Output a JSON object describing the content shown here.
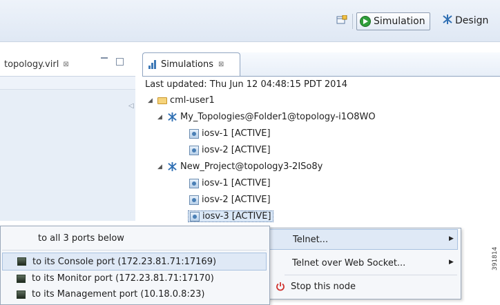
{
  "toolbar": {
    "open_perspective_icon": "open-perspective-icon",
    "perspectives": [
      {
        "label": "Simulation",
        "icon": "simulation-play-icon",
        "active": true
      },
      {
        "label": "Design",
        "icon": "design-topology-icon",
        "active": false
      }
    ]
  },
  "left_panel": {
    "tab_label": "topology.virl",
    "close_glyph": "⊠",
    "collapse_glyph": "◁"
  },
  "simulations": {
    "tab_label": "Simulations",
    "close_glyph": "⊠",
    "last_updated": "Last updated: Thu Jun 12 04:48:15 PDT 2014",
    "tree": {
      "user": "cml-user1",
      "topologies": [
        {
          "label": "My_Topologies@Folder1@topology-i1O8WO",
          "nodes": [
            "iosv-1 [ACTIVE]",
            "iosv-2 [ACTIVE]"
          ]
        },
        {
          "label": "New_Project@topology3-2ISo8y",
          "nodes": [
            "iosv-1 [ACTIVE]",
            "iosv-2 [ACTIVE]",
            "iosv-3 [ACTIVE]"
          ]
        }
      ]
    }
  },
  "context_menu": {
    "items": [
      {
        "label": "Telnet...",
        "submenu": true,
        "highlighted": true
      },
      {
        "label": "Telnet over Web Socket...",
        "submenu": true,
        "highlighted": false
      },
      {
        "label": "Stop this node",
        "icon": "power-icon",
        "highlighted": false
      }
    ]
  },
  "telnet_submenu": {
    "items": [
      {
        "label": "to all 3 ports below",
        "icon": null,
        "highlighted": false
      },
      {
        "label": "to its Console port (172.23.81.71:17169)",
        "icon": "terminal-icon",
        "highlighted": true
      },
      {
        "label": "to its Monitor port (172.23.81.71:17170)",
        "icon": "terminal-icon",
        "highlighted": false
      },
      {
        "label": "to its Management port (10.18.0.8:23)",
        "icon": "terminal-icon",
        "highlighted": false
      }
    ]
  },
  "watermark": "391814",
  "colors": {
    "accent": "#2f9e3a",
    "selection": "#dfe9f6",
    "panel_bg": "#e7eef7"
  }
}
